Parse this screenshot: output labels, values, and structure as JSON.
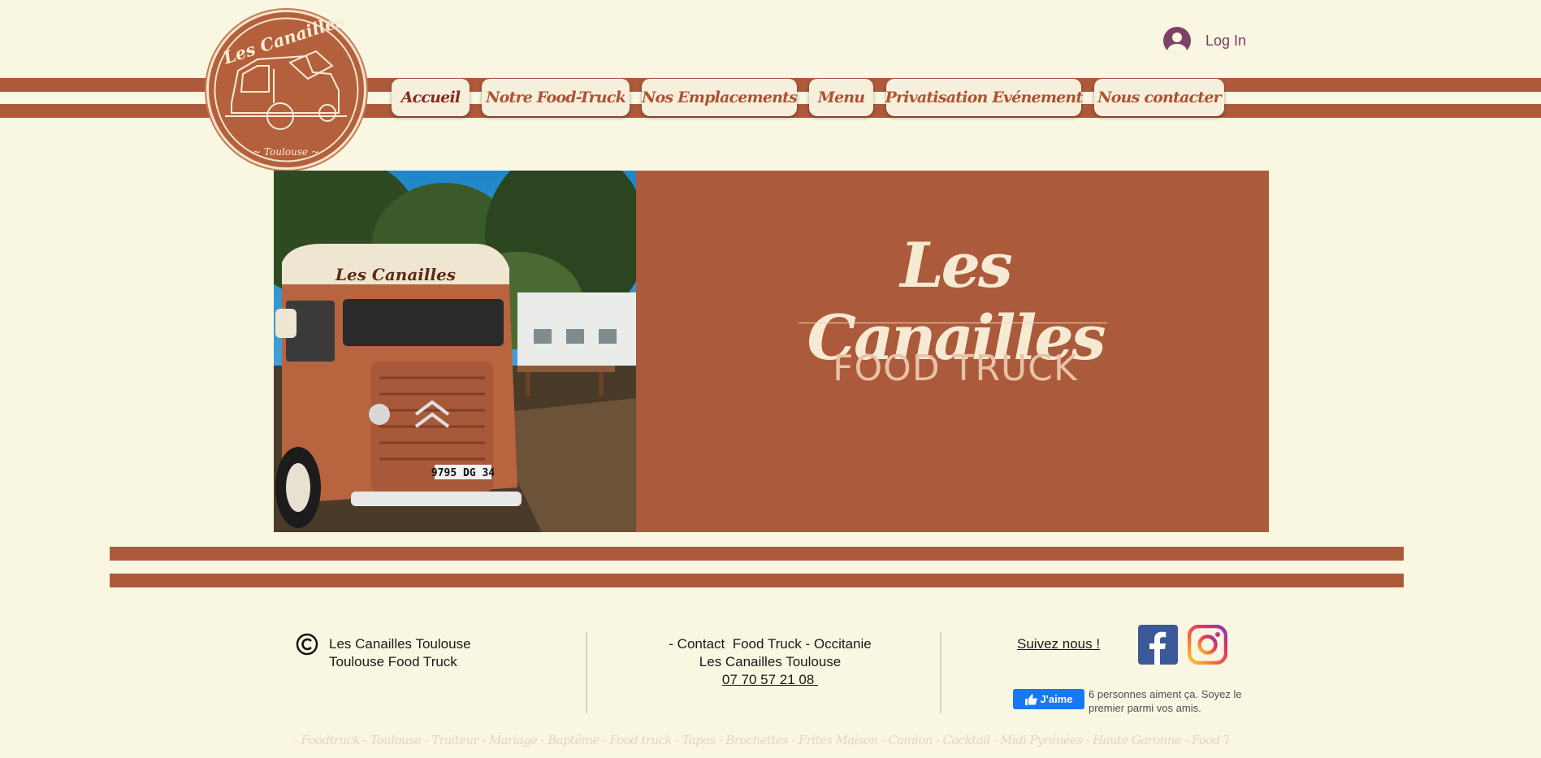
{
  "header": {
    "login_label": "Log In",
    "logo": {
      "text_top": "Les Canailles",
      "text_bottom": "~ Toulouse ~"
    }
  },
  "nav": {
    "items": [
      {
        "label": "Accueil",
        "active": true
      },
      {
        "label": "Notre Food-Truck",
        "active": false
      },
      {
        "label": "Nos Emplacements",
        "active": false
      },
      {
        "label": "Menu",
        "active": false
      },
      {
        "label": "Privatisation Evénement",
        "active": false
      },
      {
        "label": "Nous contacter",
        "active": false
      }
    ]
  },
  "hero": {
    "title": "Les Canailles",
    "subtitle": "FOOD TRUCK",
    "photo": {
      "truck_sign": "Les Canailles",
      "plate": "9795 DG 34"
    }
  },
  "footer": {
    "company_line1": "Les Canailles Toulouse",
    "company_line2": "Toulouse Food Truck",
    "contact_line1": "- Contact  Food Truck - Occitanie",
    "contact_line2": "Les Canailles Toulouse",
    "phone": "07 70 57 21 08 ",
    "follow_label": "Suivez nous !",
    "like_button": "J'aime",
    "like_text": "6 personnes aiment ça. Soyez le premier parmi vos amis.",
    "keywords": "- Foodtruck - Toulouse - Traiteur - Mariage - Baptême - Food truck - Tapas - Brochettes - Frites Maison - Camion - Cocktail - Midi Pyrénées - Haute Garonne - Food Truck Toulouse"
  },
  "colors": {
    "background": "#f9f6e1",
    "brand_rust": "#ad5a3b",
    "nav_button": "#f6efdc",
    "nav_text": "#b0512f",
    "facebook": "#3b5998"
  },
  "icons": [
    "copyright-icon",
    "user-avatar-icon",
    "facebook-icon",
    "instagram-icon",
    "thumbs-up-icon"
  ]
}
